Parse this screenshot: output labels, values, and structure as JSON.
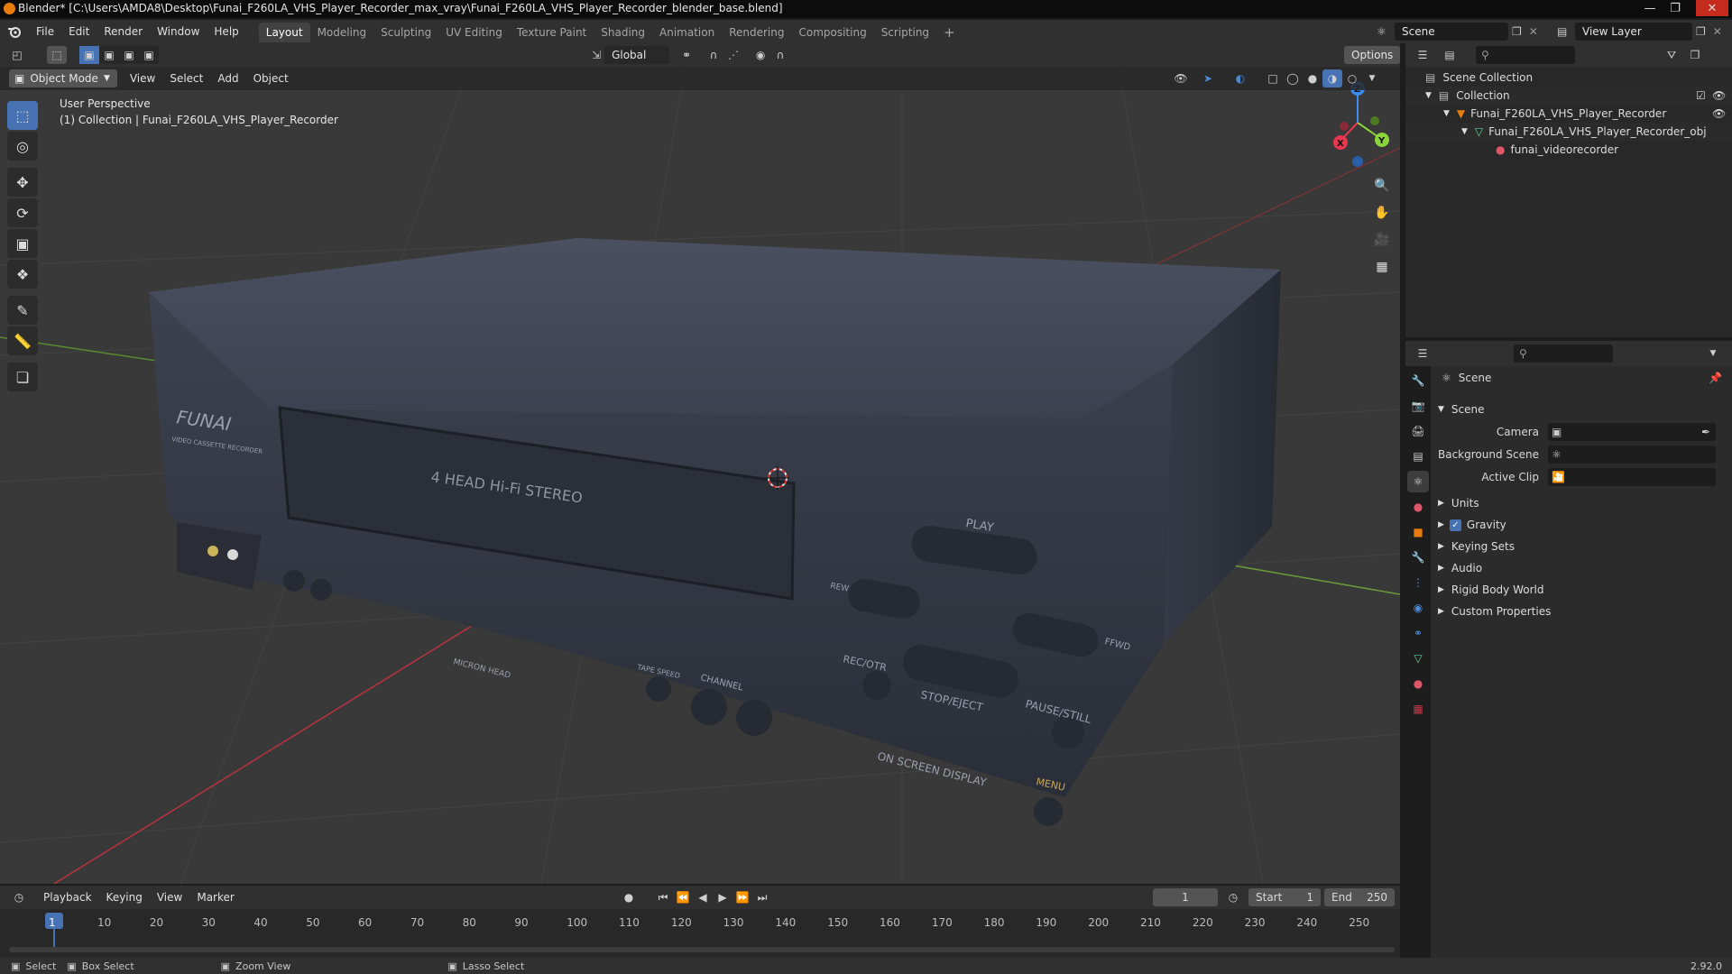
{
  "window": {
    "title": "Blender* [C:\\Users\\AMDA8\\Desktop\\Funai_F260LA_VHS_Player_Recorder_max_vray\\Funai_F260LA_VHS_Player_Recorder_blender_base.blend]"
  },
  "menu": {
    "items": [
      "File",
      "Edit",
      "Render",
      "Window",
      "Help"
    ]
  },
  "workspaces": {
    "tabs": [
      "Layout",
      "Modeling",
      "Sculpting",
      "UV Editing",
      "Texture Paint",
      "Shading",
      "Animation",
      "Rendering",
      "Compositing",
      "Scripting"
    ],
    "active": "Layout",
    "add": "+"
  },
  "top_right": {
    "scene": "Scene",
    "view_layer": "View Layer"
  },
  "header": {
    "transform_orientation": "Global",
    "options": "Options"
  },
  "viewport_header": {
    "mode": "Object Mode",
    "menus": [
      "View",
      "Select",
      "Add",
      "Object"
    ]
  },
  "viewport": {
    "perspective": "User Perspective",
    "collection_info": "(1) Collection | Funai_F260LA_VHS_Player_Recorder",
    "gizmo": {
      "x": "X",
      "y": "Y",
      "z": "Z"
    },
    "model_texts": {
      "brand": "FUNAI",
      "tagline": "VIDEO CASSETTE RECORDER",
      "hifi": "4 HEAD Hi-Fi STEREO",
      "play": "PLAY",
      "rew": "REW",
      "ffwd": "FFWD",
      "rec": "REC/OTR",
      "stop": "STOP/EJECT",
      "pause": "PAUSE/STILL",
      "tape_speed": "TAPE SPEED",
      "channel": "CHANNEL",
      "osd": "ON SCREEN DISPLAY",
      "menu": "MENU",
      "micron": "MICRON HEAD"
    }
  },
  "outliner": {
    "items": [
      {
        "label": "Scene Collection",
        "depth": 0
      },
      {
        "label": "Collection",
        "depth": 1
      },
      {
        "label": "Funai_F260LA_VHS_Player_Recorder",
        "depth": 2
      },
      {
        "label": "Funai_F260LA_VHS_Player_Recorder_obj",
        "depth": 3
      },
      {
        "label": "funai_videorecorder",
        "depth": 4
      }
    ]
  },
  "properties": {
    "context": "Scene",
    "section": "Scene",
    "fields": [
      {
        "label": "Camera"
      },
      {
        "label": "Background Scene"
      },
      {
        "label": "Active Clip"
      }
    ],
    "panels": [
      "Units",
      "Gravity",
      "Keying Sets",
      "Audio",
      "Rigid Body World",
      "Custom Properties"
    ]
  },
  "timeline": {
    "menus": [
      "Playback",
      "Keying",
      "View",
      "Marker"
    ],
    "current_frame": "1",
    "start_label": "Start",
    "start": "1",
    "end_label": "End",
    "end": "250",
    "ticks": [
      "1",
      "10",
      "20",
      "30",
      "40",
      "50",
      "60",
      "70",
      "80",
      "90",
      "100",
      "110",
      "120",
      "130",
      "140",
      "150",
      "160",
      "170",
      "180",
      "190",
      "200",
      "210",
      "220",
      "230",
      "240",
      "250"
    ]
  },
  "status": {
    "select": "Select",
    "box_select": "Box Select",
    "zoom_view": "Zoom View",
    "lasso_select": "Lasso Select",
    "version": "2.92.0"
  },
  "colors": {
    "accent": "#4772b3",
    "orange": "#e87d0d",
    "gizmo_x": "#e8364f",
    "gizmo_y": "#8bd53a",
    "gizmo_z": "#3b8ef0"
  }
}
